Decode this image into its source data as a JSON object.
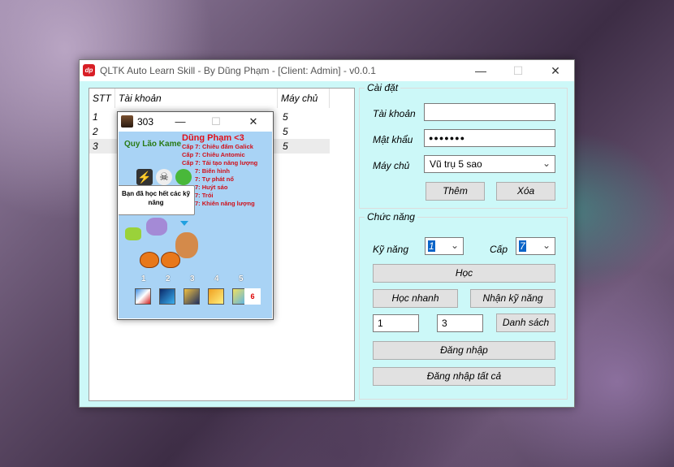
{
  "window": {
    "title": "QLTK Auto Learn Skill - By Dũng Phạm - [Client: Admin] - v0.0.1",
    "app_icon_text": "dp"
  },
  "table": {
    "columns": [
      "STT",
      "Tài khoản",
      "Máy chủ"
    ],
    "rows": [
      {
        "stt": "1",
        "tai_khoan": "",
        "may_chu": "5"
      },
      {
        "stt": "2",
        "tai_khoan": "",
        "may_chu": "5"
      },
      {
        "stt": "3",
        "tai_khoan": "",
        "may_chu": "5"
      }
    ]
  },
  "settings": {
    "group_label": "Cài đặt",
    "account_label": "Tài khoản",
    "account_value": "",
    "password_label": "Mật khẩu",
    "password_value": "●●●●●●●",
    "server_label": "Máy chủ",
    "server_value": "Vũ trụ 5 sao",
    "add_button": "Thêm",
    "delete_button": "Xóa"
  },
  "functions": {
    "group_label": "Chức năng",
    "skill_label": "Kỹ năng",
    "skill_value": "1",
    "level_label": "Cấp",
    "level_value": "7",
    "learn_button": "Học",
    "learn_fast_button": "Học nhanh",
    "receive_skill_button": "Nhận kỹ năng",
    "range_from": "1",
    "range_to": "3",
    "list_button": "Danh sách",
    "login_button": "Đăng nhập",
    "login_all_button": "Đăng nhập tất cả"
  },
  "popup": {
    "title": "303",
    "character_name": "Dũng Phạm <3",
    "subtitle": "Quy Lão Kame",
    "skills": [
      "Cấp 7: Chiêu đấm Galick",
      "Cấp 7: Chiêu Antomic",
      "Cấp 7: Tái tạo năng lượng",
      "7: Biến hình",
      "7: Tự phát nổ",
      "7: Huýt sáo",
      "7: Trói",
      "7: Khiên năng lượng"
    ],
    "bubble_text": "Bạn đã học hết các kỹ năng",
    "slot_numbers": [
      "1",
      "2",
      "3",
      "4",
      "5"
    ],
    "slot_extra": "6",
    "colors": {
      "game_bg": "#a9d3f5",
      "name_red": "#e0101a",
      "subtitle_green": "#2a7a16"
    }
  },
  "colors": {
    "client_bg": "#ccf8f8",
    "button_bg": "#e1e1e1",
    "selection_blue": "#0a64c8"
  }
}
